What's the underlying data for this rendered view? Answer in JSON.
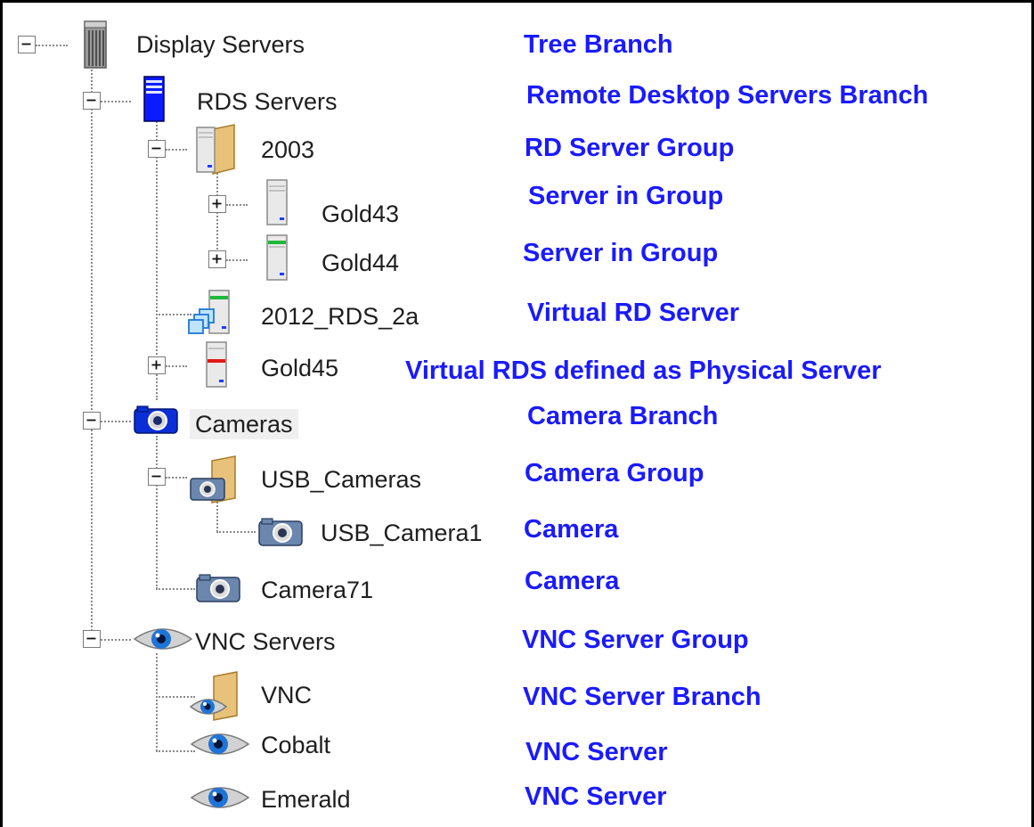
{
  "tree": {
    "display_servers": {
      "label": "Display Servers",
      "icon": "server-rack-icon",
      "expanded": true
    },
    "rds_servers": {
      "label": "RDS Servers",
      "icon": "blue-server-icon",
      "expanded": true
    },
    "group_2003": {
      "label": "2003",
      "icon": "server-folder-icon",
      "expanded": true
    },
    "gold43": {
      "label": "Gold43",
      "icon": "server-icon",
      "expanded": false
    },
    "gold44": {
      "label": "Gold44",
      "icon": "server-green-icon",
      "expanded": false
    },
    "rds_2012": {
      "label": "2012_RDS_2a",
      "icon": "virtual-server-icon"
    },
    "gold45": {
      "label": "Gold45",
      "icon": "server-red-icon",
      "expanded": false
    },
    "cameras": {
      "label": "Cameras",
      "icon": "camera-blue-icon",
      "expanded": true,
      "selected": true
    },
    "usb_cameras": {
      "label": "USB_Cameras",
      "icon": "camera-folder-icon",
      "expanded": true
    },
    "usb_camera1": {
      "label": "USB_Camera1",
      "icon": "camera-icon"
    },
    "camera71": {
      "label": "Camera71",
      "icon": "camera-icon"
    },
    "vnc_servers": {
      "label": "VNC Servers",
      "icon": "eye-icon",
      "expanded": true
    },
    "vnc": {
      "label": "VNC",
      "icon": "eye-folder-icon"
    },
    "cobalt": {
      "label": "Cobalt",
      "icon": "eye-icon"
    },
    "emerald": {
      "label": "Emerald",
      "icon": "eye-icon"
    }
  },
  "annotations": {
    "tree_branch": "Tree Branch",
    "rds_branch": "Remote Desktop Servers Branch",
    "rd_server_group": "RD Server Group",
    "server_in_group_1": "Server in Group",
    "server_in_group_2": "Server in Group",
    "virtual_rd_server": "Virtual RD Server",
    "virtual_rds_physical": "Virtual RDS defined as Physical Server",
    "camera_branch": "Camera Branch",
    "camera_group": "Camera Group",
    "camera_1": "Camera",
    "camera_2": "Camera",
    "vnc_server_group": "VNC Server Group",
    "vnc_server_branch": "VNC Server Branch",
    "vnc_server_1": "VNC Server",
    "vnc_server_2": "VNC Server"
  },
  "colors": {
    "annotation": "#1a1aff",
    "selection": "#efefef",
    "tree_lines": "#8a8a8a",
    "rds_blue": "#0a1cff",
    "led_green": "#1fb83a",
    "led_red": "#e01818"
  }
}
